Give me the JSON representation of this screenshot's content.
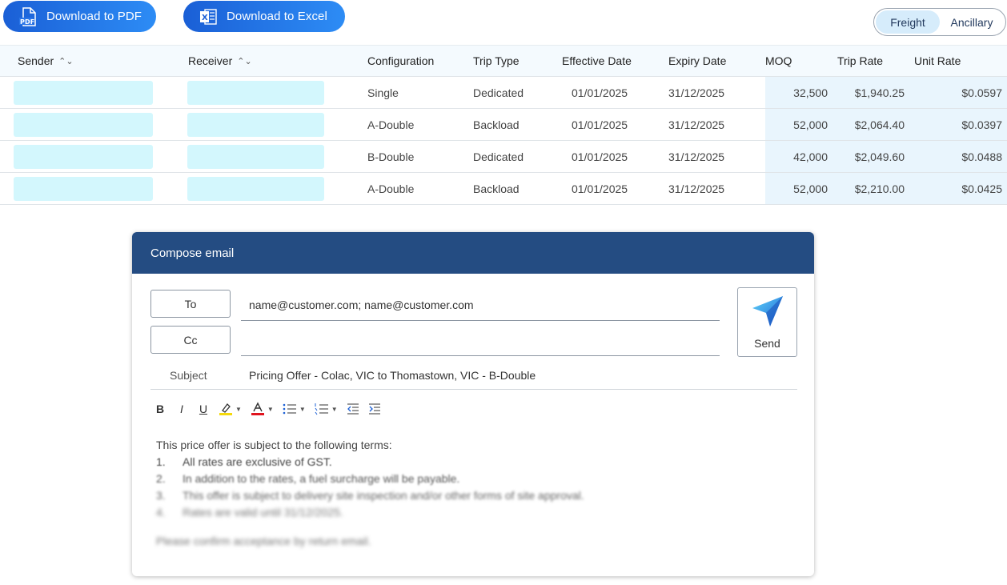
{
  "toolbar": {
    "pdf_label": "Download to PDF",
    "pdf_icon_text": "PDF",
    "excel_label": "Download to Excel",
    "excel_icon_text": "X",
    "tabs": [
      "Freight",
      "Ancillary"
    ],
    "active_tab": "Freight"
  },
  "table": {
    "headers": {
      "sender": "Sender",
      "receiver": "Receiver",
      "configuration": "Configuration",
      "trip_type": "Trip Type",
      "effective_date": "Effective Date",
      "expiry_date": "Expiry Date",
      "moq": "MOQ",
      "trip_rate": "Trip Rate",
      "unit_rate": "Unit Rate"
    },
    "rows": [
      {
        "configuration": "Single",
        "trip_type": "Dedicated",
        "effective_date": "01/01/2025",
        "expiry_date": "31/12/2025",
        "moq": "32,500",
        "trip_rate": "$1,940.25",
        "unit_rate": "$0.0597"
      },
      {
        "configuration": "A-Double",
        "trip_type": "Backload",
        "effective_date": "01/01/2025",
        "expiry_date": "31/12/2025",
        "moq": "52,000",
        "trip_rate": "$2,064.40",
        "unit_rate": "$0.0397"
      },
      {
        "configuration": "B-Double",
        "trip_type": "Dedicated",
        "effective_date": "01/01/2025",
        "expiry_date": "31/12/2025",
        "moq": "42,000",
        "trip_rate": "$2,049.60",
        "unit_rate": "$0.0488"
      },
      {
        "configuration": "A-Double",
        "trip_type": "Backload",
        "effective_date": "01/01/2025",
        "expiry_date": "31/12/2025",
        "moq": "52,000",
        "trip_rate": "$2,210.00",
        "unit_rate": "$0.0425"
      }
    ]
  },
  "compose": {
    "title": "Compose email",
    "to_label": "To",
    "cc_label": "Cc",
    "to_value": "name@customer.com; name@customer.com",
    "cc_value": "",
    "send_label": "Send",
    "subject_label": "Subject",
    "subject_value": "Pricing Offer - Colac, VIC to Thomastown, VIC - B-Double",
    "editor_tools": {
      "bold": "B",
      "italic": "I",
      "underline": "U"
    },
    "body": {
      "intro": "This price offer is subject to the following terms:",
      "terms": [
        {
          "n": "1.",
          "text": "All rates are exclusive of GST."
        },
        {
          "n": "2.",
          "text": "In addition to the rates, a fuel surcharge will be payable."
        },
        {
          "n": "3.",
          "text": "This offer is subject to delivery site inspection and/or other forms of site approval."
        },
        {
          "n": "4.",
          "text": "Rates are valid until 31/12/2025."
        }
      ],
      "closing": "Please confirm acceptance by return email."
    }
  },
  "colors": {
    "accent": "#1a5fd6",
    "header_bg": "#244c82",
    "redacted_cell": "#d3f7fd",
    "rate_shade": "#e9f5fd",
    "highlight": "#f5d90a",
    "font_color": "#e0141e"
  },
  "icons": [
    "pdf-file-icon",
    "excel-file-icon",
    "sort-icon",
    "send-plane-icon",
    "highlight-icon",
    "font-color-icon",
    "bullet-list-icon",
    "numbered-list-icon",
    "outdent-icon",
    "indent-icon"
  ]
}
